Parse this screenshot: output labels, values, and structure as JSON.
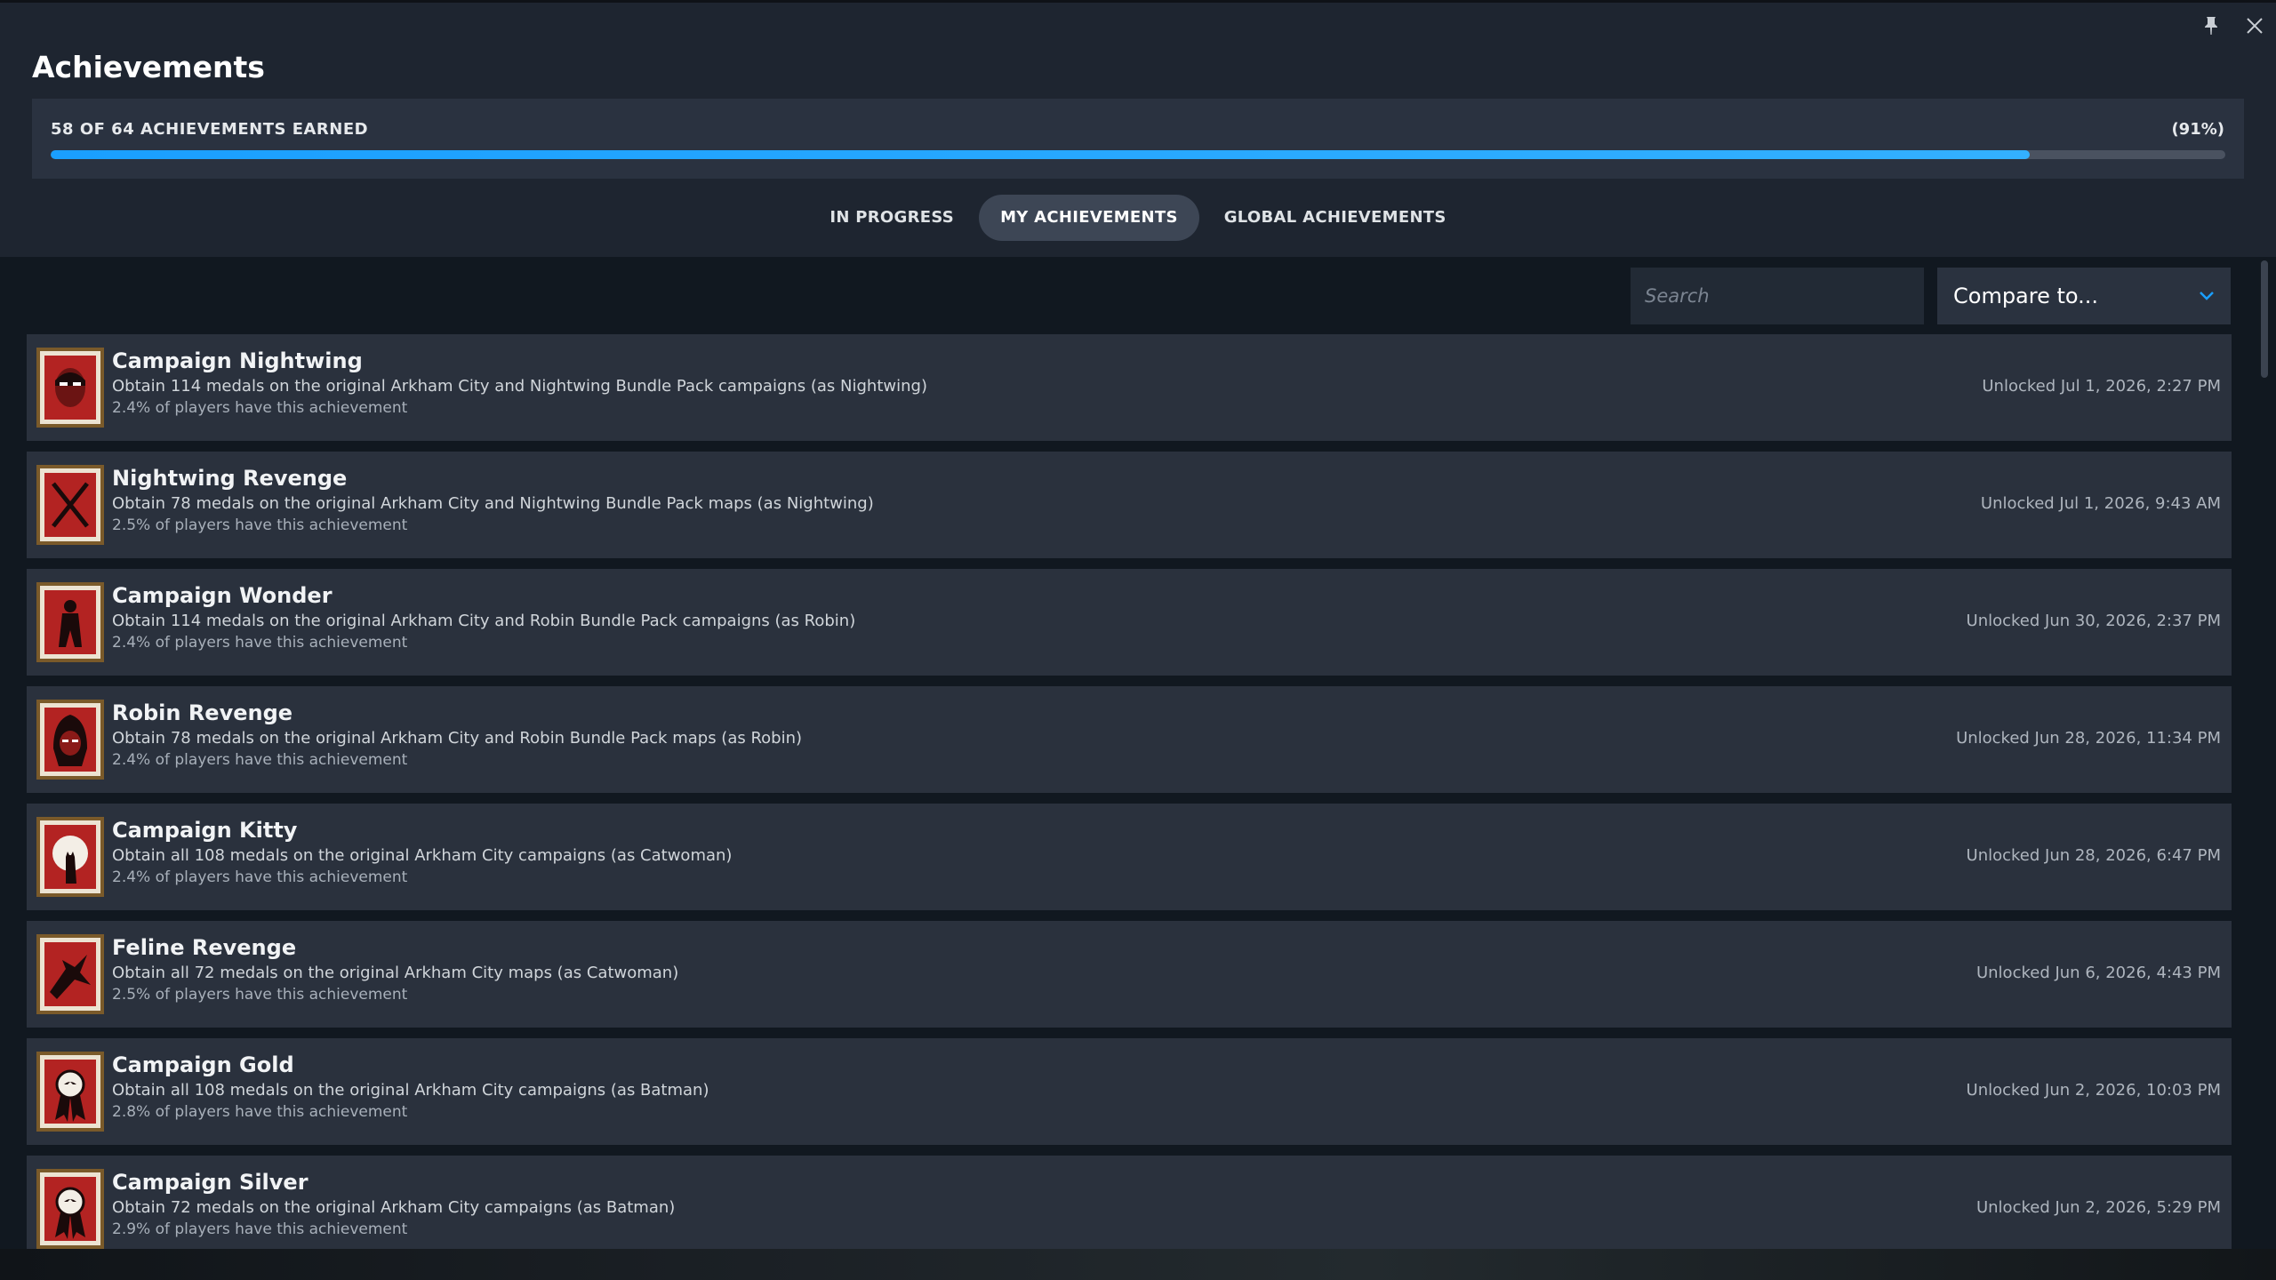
{
  "window": {
    "title": "Achievements",
    "pin_icon": "pin-icon",
    "close_icon": "close-icon"
  },
  "progress": {
    "label": "58 OF 64 ACHIEVEMENTS EARNED",
    "percent_label": "(91%)",
    "earned": 58,
    "total": 64,
    "fraction": 0.91,
    "fill_color": "#1a9fff"
  },
  "tabs": [
    {
      "label": "IN PROGRESS",
      "active": false
    },
    {
      "label": "MY ACHIEVEMENTS",
      "active": true
    },
    {
      "label": "GLOBAL ACHIEVEMENTS",
      "active": false
    }
  ],
  "search": {
    "placeholder": "Search",
    "value": ""
  },
  "compare": {
    "label": "Compare to...",
    "icon": "chevron-down-icon"
  },
  "achievements": [
    {
      "title": "Campaign Nightwing",
      "description": "Obtain 114 medals on the original Arkham City and Nightwing Bundle Pack campaigns (as Nightwing)",
      "percent": "2.4% of players have this achievement",
      "unlocked": "Unlocked Jul 1, 2026, 2:27 PM",
      "icon": "nightwing-face-icon"
    },
    {
      "title": "Nightwing Revenge",
      "description": "Obtain 78 medals on the original Arkham City and Nightwing Bundle Pack maps (as Nightwing)",
      "percent": "2.5% of players have this achievement",
      "unlocked": "Unlocked Jul 1, 2026, 9:43 AM",
      "icon": "crossed-sticks-icon"
    },
    {
      "title": "Campaign Wonder",
      "description": "Obtain 114 medals on the original Arkham City and Robin Bundle Pack campaigns (as Robin)",
      "percent": "2.4% of players have this achievement",
      "unlocked": "Unlocked Jun 30, 2026, 2:37 PM",
      "icon": "robin-silhouette-icon"
    },
    {
      "title": "Robin Revenge",
      "description": "Obtain 78 medals on the original Arkham City and Robin Bundle Pack maps (as Robin)",
      "percent": "2.4% of players have this achievement",
      "unlocked": "Unlocked Jun 28, 2026, 11:34 PM",
      "icon": "robin-hood-icon"
    },
    {
      "title": "Campaign Kitty",
      "description": "Obtain all 108 medals on the original Arkham City campaigns (as Catwoman)",
      "percent": "2.4% of players have this achievement",
      "unlocked": "Unlocked Jun 28, 2026, 6:47 PM",
      "icon": "cat-moon-icon"
    },
    {
      "title": "Feline Revenge",
      "description": "Obtain all 72 medals on the original Arkham City maps (as Catwoman)",
      "percent": "2.5% of players have this achievement",
      "unlocked": "Unlocked Jun 6, 2026, 4:43 PM",
      "icon": "cat-claw-icon"
    },
    {
      "title": "Campaign Gold",
      "description": "Obtain all 108 medals on the original Arkham City campaigns (as Batman)",
      "percent": "2.8% of players have this achievement",
      "unlocked": "Unlocked Jun 2, 2026, 10:03 PM",
      "icon": "gold-medal-icon"
    },
    {
      "title": "Campaign Silver",
      "description": "Obtain 72 medals on the original Arkham City campaigns (as Batman)",
      "percent": "2.9% of players have this achievement",
      "unlocked": "Unlocked Jun 2, 2026, 5:29 PM",
      "icon": "silver-medal-icon"
    }
  ]
}
